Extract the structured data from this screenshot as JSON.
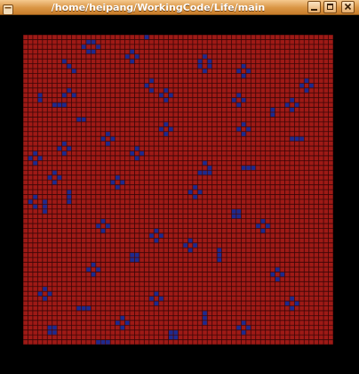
{
  "window": {
    "title": "/home/heipang/WorkingCode/Life/main",
    "controls": {
      "minimize_icon": "minimize-icon",
      "maximize_icon": "maximize-icon",
      "close_icon": "close-icon"
    }
  },
  "game": {
    "rows": 64,
    "cols": 64,
    "colors": {
      "dead": "#9e1a16",
      "grid": "#3a0606",
      "alive": "#1e2a8e",
      "background": "#000000"
    },
    "live_cells": [
      [
        0,
        25
      ],
      [
        1,
        13
      ],
      [
        1,
        14
      ],
      [
        2,
        12
      ],
      [
        2,
        15
      ],
      [
        3,
        13
      ],
      [
        3,
        14
      ],
      [
        3,
        22
      ],
      [
        4,
        21
      ],
      [
        4,
        23
      ],
      [
        5,
        22
      ],
      [
        4,
        37
      ],
      [
        5,
        36
      ],
      [
        5,
        38
      ],
      [
        6,
        36
      ],
      [
        6,
        38
      ],
      [
        7,
        37
      ],
      [
        6,
        45
      ],
      [
        7,
        44
      ],
      [
        7,
        46
      ],
      [
        8,
        45
      ],
      [
        9,
        58
      ],
      [
        10,
        57
      ],
      [
        10,
        59
      ],
      [
        11,
        58
      ],
      [
        9,
        26
      ],
      [
        10,
        25
      ],
      [
        11,
        26
      ],
      [
        11,
        9
      ],
      [
        12,
        8
      ],
      [
        12,
        10
      ],
      [
        12,
        3
      ],
      [
        13,
        3
      ],
      [
        11,
        29
      ],
      [
        12,
        28
      ],
      [
        12,
        30
      ],
      [
        13,
        29
      ],
      [
        12,
        44
      ],
      [
        13,
        43
      ],
      [
        13,
        45
      ],
      [
        14,
        44
      ],
      [
        13,
        55
      ],
      [
        14,
        54
      ],
      [
        14,
        56
      ],
      [
        15,
        55
      ],
      [
        15,
        51
      ],
      [
        16,
        51
      ],
      [
        14,
        6
      ],
      [
        14,
        7
      ],
      [
        14,
        8
      ],
      [
        18,
        29
      ],
      [
        19,
        28
      ],
      [
        19,
        30
      ],
      [
        20,
        29
      ],
      [
        18,
        45
      ],
      [
        19,
        44
      ],
      [
        19,
        46
      ],
      [
        20,
        45
      ],
      [
        20,
        17
      ],
      [
        21,
        16
      ],
      [
        21,
        18
      ],
      [
        22,
        17
      ],
      [
        21,
        55
      ],
      [
        21,
        56
      ],
      [
        21,
        57
      ],
      [
        23,
        23
      ],
      [
        24,
        22
      ],
      [
        24,
        24
      ],
      [
        25,
        23
      ],
      [
        22,
        8
      ],
      [
        23,
        7
      ],
      [
        23,
        9
      ],
      [
        24,
        8
      ],
      [
        24,
        2
      ],
      [
        25,
        1
      ],
      [
        25,
        3
      ],
      [
        26,
        2
      ],
      [
        27,
        45
      ],
      [
        27,
        46
      ],
      [
        27,
        47
      ],
      [
        28,
        6
      ],
      [
        29,
        5
      ],
      [
        29,
        7
      ],
      [
        30,
        6
      ],
      [
        29,
        19
      ],
      [
        30,
        18
      ],
      [
        30,
        20
      ],
      [
        31,
        19
      ],
      [
        31,
        35
      ],
      [
        32,
        34
      ],
      [
        32,
        36
      ],
      [
        33,
        35
      ],
      [
        32,
        9
      ],
      [
        33,
        9
      ],
      [
        34,
        9
      ],
      [
        34,
        4
      ],
      [
        35,
        4
      ],
      [
        36,
        4
      ],
      [
        33,
        2
      ],
      [
        35,
        2
      ],
      [
        34,
        1
      ],
      [
        38,
        16
      ],
      [
        39,
        15
      ],
      [
        39,
        17
      ],
      [
        40,
        16
      ],
      [
        38,
        49
      ],
      [
        39,
        48
      ],
      [
        39,
        50
      ],
      [
        40,
        49
      ],
      [
        40,
        27
      ],
      [
        41,
        26
      ],
      [
        41,
        28
      ],
      [
        42,
        27
      ],
      [
        42,
        34
      ],
      [
        43,
        33
      ],
      [
        43,
        35
      ],
      [
        44,
        34
      ],
      [
        45,
        22
      ],
      [
        45,
        23
      ],
      [
        46,
        22
      ],
      [
        46,
        23
      ],
      [
        47,
        14
      ],
      [
        48,
        13
      ],
      [
        48,
        15
      ],
      [
        49,
        14
      ],
      [
        48,
        52
      ],
      [
        49,
        51
      ],
      [
        49,
        53
      ],
      [
        50,
        52
      ],
      [
        52,
        4
      ],
      [
        53,
        3
      ],
      [
        53,
        5
      ],
      [
        54,
        4
      ],
      [
        53,
        27
      ],
      [
        54,
        26
      ],
      [
        54,
        28
      ],
      [
        55,
        27
      ],
      [
        54,
        55
      ],
      [
        55,
        54
      ],
      [
        55,
        56
      ],
      [
        56,
        55
      ],
      [
        56,
        11
      ],
      [
        56,
        12
      ],
      [
        56,
        13
      ],
      [
        58,
        20
      ],
      [
        59,
        19
      ],
      [
        59,
        21
      ],
      [
        60,
        20
      ],
      [
        59,
        45
      ],
      [
        60,
        44
      ],
      [
        60,
        46
      ],
      [
        61,
        45
      ],
      [
        61,
        30
      ],
      [
        61,
        31
      ],
      [
        62,
        30
      ],
      [
        62,
        31
      ],
      [
        60,
        5
      ],
      [
        60,
        6
      ],
      [
        61,
        5
      ],
      [
        61,
        6
      ],
      [
        57,
        37
      ],
      [
        58,
        37
      ],
      [
        59,
        37
      ],
      [
        63,
        15
      ],
      [
        63,
        16
      ],
      [
        63,
        17
      ],
      [
        26,
        37
      ],
      [
        27,
        38
      ],
      [
        28,
        36
      ],
      [
        28,
        37
      ],
      [
        28,
        38
      ],
      [
        44,
        40
      ],
      [
        45,
        40
      ],
      [
        46,
        40
      ],
      [
        5,
        8
      ],
      [
        6,
        9
      ],
      [
        7,
        10
      ],
      [
        17,
        11
      ],
      [
        17,
        12
      ],
      [
        36,
        43
      ],
      [
        36,
        44
      ],
      [
        37,
        43
      ],
      [
        37,
        44
      ]
    ]
  }
}
